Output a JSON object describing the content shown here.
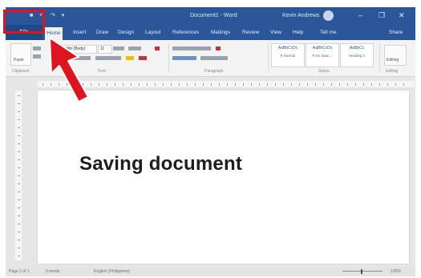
{
  "app": {
    "window_title": "Document1 - Word",
    "user_name": "Kevin Andrews",
    "qat_glyphs": "■ ↶ ↷ ▾",
    "window_controls": [
      "‒",
      "❐",
      "✕"
    ]
  },
  "tabs": {
    "file": "File",
    "home": "Home",
    "items": [
      "Insert",
      "Draw",
      "Design",
      "Layout",
      "References",
      "Mailings",
      "Review",
      "View",
      "Help",
      "Tell me",
      "Share"
    ]
  },
  "ribbon": {
    "font_name": "Calibri (Body)",
    "font_size": "11",
    "group_labels": [
      "Clipboard",
      "Font",
      "Paragraph",
      "Styles",
      "Editing"
    ],
    "paste_label": "Paste",
    "styles": [
      {
        "sample": "AaBbCcDc",
        "name": "¶ Normal"
      },
      {
        "sample": "AaBbCcDc",
        "name": "¶ No Spac..."
      },
      {
        "sample": "AaBbCc",
        "name": "Heading 1"
      }
    ],
    "editing_label": "Editing"
  },
  "document": {
    "text": "Saving document"
  },
  "statusbar": {
    "page": "Page 1 of 1",
    "words": "0 words",
    "language": "English (Philippines)",
    "zoom": "100%"
  },
  "colors": {
    "accent": "#2b579a",
    "highlight_box": "#e0141e",
    "arrow": "#e0141e"
  },
  "annotation": {
    "type": "arrow-pointing-to-file-tab"
  }
}
